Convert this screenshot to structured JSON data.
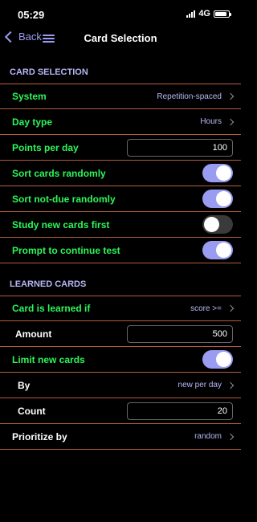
{
  "status_bar": {
    "time": "05:29",
    "network": "4G",
    "battery_level": 0.85
  },
  "nav": {
    "back_label": "Back",
    "title": "Card Selection"
  },
  "card_selection": {
    "header": "CARD SELECTION",
    "system": {
      "label": "System",
      "value": "Repetition-spaced"
    },
    "day_type": {
      "label": "Day type",
      "value": "Hours"
    },
    "points_per_day": {
      "label": "Points per day",
      "value": "100"
    },
    "sort_cards_randomly": {
      "label": "Sort cards randomly",
      "on": true
    },
    "sort_not_due_randomly": {
      "label": "Sort not-due randomly",
      "on": true
    },
    "study_new_cards_first": {
      "label": "Study new cards first",
      "on": false
    },
    "prompt_to_continue_test": {
      "label": "Prompt to continue test",
      "on": true
    }
  },
  "learned_cards": {
    "header": "LEARNED CARDS",
    "card_is_learned_if": {
      "label": "Card is learned if",
      "value": "score >="
    },
    "amount": {
      "label": "Amount",
      "value": "500"
    },
    "limit_new_cards": {
      "label": "Limit new cards",
      "on": true
    },
    "by": {
      "label": "By",
      "value": "new per day"
    },
    "count": {
      "label": "Count",
      "value": "20"
    },
    "prioritize_by": {
      "label": "Prioritize by",
      "value": "random"
    }
  },
  "colors": {
    "accent": "#9a9cf2",
    "label_green": "#2df65a",
    "separator": "#b35c3c",
    "section_header": "#b5b6f4",
    "toggle_off": "#3a3a3c"
  }
}
